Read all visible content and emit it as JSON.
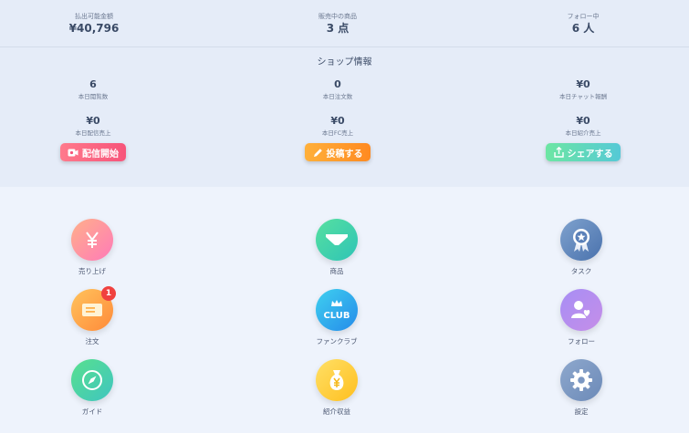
{
  "summary": [
    {
      "label": "払出可能金額",
      "value": "¥40,796"
    },
    {
      "label": "販売中の商品",
      "value": "3 点"
    },
    {
      "label": "フォロー中",
      "value": "6 人"
    }
  ],
  "shop": {
    "title": "ショップ情報",
    "stats_row1": [
      {
        "value": "6",
        "label": "本日閲覧数"
      },
      {
        "value": "0",
        "label": "本日注文数"
      },
      {
        "value": "¥0",
        "label": "本日チャット報酬"
      }
    ],
    "stats_row2": [
      {
        "value": "¥0",
        "label": "本日配信売上"
      },
      {
        "value": "¥0",
        "label": "本日FC売上"
      },
      {
        "value": "¥0",
        "label": "本日紹介売上"
      }
    ],
    "buttons": {
      "live": "配信開始",
      "post": "投稿する",
      "share": "シェアする"
    }
  },
  "menu": [
    {
      "label": "売り上げ",
      "icon": "yen-icon"
    },
    {
      "label": "商品",
      "icon": "shirt-icon"
    },
    {
      "label": "タスク",
      "icon": "medal-icon"
    },
    {
      "label": "注文",
      "icon": "card-icon",
      "badge": "1"
    },
    {
      "label": "ファンクラブ",
      "icon": "club-icon",
      "icon_text": "CLUB"
    },
    {
      "label": "フォロー",
      "icon": "user-heart-icon"
    },
    {
      "label": "ガイド",
      "icon": "compass-icon"
    },
    {
      "label": "紹介収益",
      "icon": "money-bag-icon"
    },
    {
      "label": "設定",
      "icon": "gear-icon"
    }
  ],
  "colors": {
    "top_bg": "#e5ecf8",
    "page_bg": "#eef3fc",
    "badge": "#f0413f"
  }
}
